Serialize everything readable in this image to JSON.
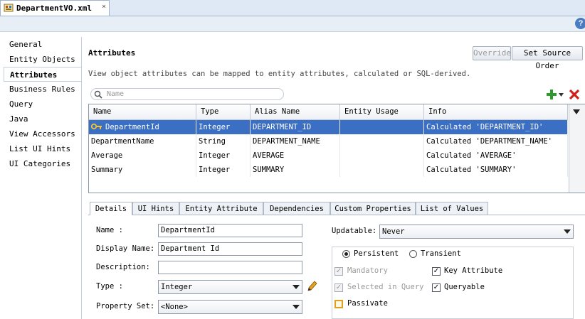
{
  "editor": {
    "tab_title": "DepartmentVO.xml",
    "tab_close": "×"
  },
  "help_icon": "?",
  "nav": {
    "items": [
      "General",
      "Entity Objects",
      "Attributes",
      "Business Rules",
      "Query",
      "Java",
      "View Accessors",
      "List UI Hints",
      "UI Categories"
    ],
    "selected_index": 2
  },
  "attributes": {
    "title": "Attributes",
    "override_label": "Override",
    "set_source_order_label": "Set Source Order",
    "description": "View object attributes can be mapped to entity attributes, calculated or SQL-derived.",
    "search_placeholder": "Name",
    "columns": [
      "Name",
      "Type",
      "Alias Name",
      "Entity Usage",
      "Info"
    ],
    "rows": [
      {
        "name": "DepartmentId",
        "type": "Integer",
        "alias": "DEPARTMENT_ID",
        "entity_usage": "",
        "info": "Calculated 'DEPARTMENT_ID'",
        "selected": true,
        "key": true
      },
      {
        "name": "DepartmentName",
        "type": "String",
        "alias": "DEPARTMENT_NAME",
        "entity_usage": "",
        "info": "Calculated 'DEPARTMENT_NAME'"
      },
      {
        "name": "Average",
        "type": "Integer",
        "alias": "AVERAGE",
        "entity_usage": "",
        "info": "Calculated 'AVERAGE'"
      },
      {
        "name": "Summary",
        "type": "Integer",
        "alias": "SUMMARY",
        "entity_usage": "",
        "info": "Calculated 'SUMMARY'"
      }
    ]
  },
  "detail_tabs": [
    "Details",
    "UI Hints",
    "Entity Attribute",
    "Dependencies",
    "Custom Properties",
    "List of Values"
  ],
  "details": {
    "name_label": "Name :",
    "name_value": "DepartmentId",
    "display_name_label": "Display Name:",
    "display_name_value": "Department Id",
    "description_label": "Description:",
    "description_value": "",
    "type_label": "Type :",
    "type_value": "Integer",
    "property_set_label": "Property Set:",
    "property_set_value": "<None>",
    "updatable_label": "Updatable:",
    "updatable_value": "Never",
    "persistent_label": "Persistent",
    "transient_label": "Transient",
    "mandatory_label": "Mandatory",
    "key_attribute_label": "Key Attribute",
    "selected_in_query_label": "Selected in Query",
    "queryable_label": "Queryable",
    "passivate_label": "Passivate",
    "check_mark": "✓"
  },
  "colors": {
    "selection": "#3b6fc4",
    "add_icon": "#2e9a2e",
    "delete_icon": "#d0201a"
  }
}
